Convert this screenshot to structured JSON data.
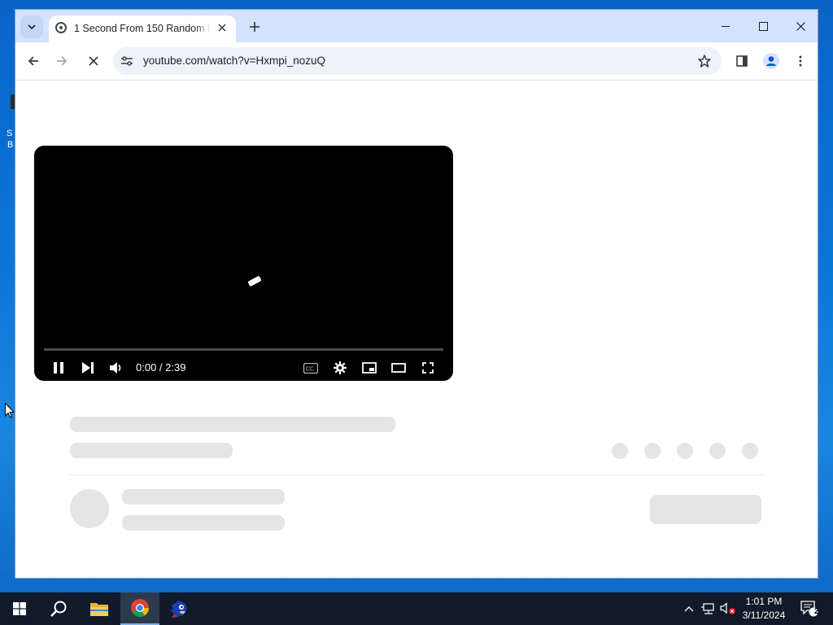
{
  "desktop": {
    "icon_text_1": "S",
    "icon_text_2": "B"
  },
  "browser": {
    "tab": {
      "title": "1 Second From 150 Random M"
    },
    "address": {
      "url": "youtube.com/watch?v=Hxmpi_nozuQ"
    }
  },
  "player": {
    "time": "0:00 / 2:39",
    "progress_fraction": 0.0,
    "state": "loading"
  },
  "taskbar": {
    "clock": {
      "time": "1:01 PM",
      "date": "3/11/2024"
    },
    "notification_count": "2"
  },
  "icons": {
    "tab_search": "chevron-down-icon",
    "favicon": "site-favicon-icon",
    "tab_close": "close-icon",
    "new_tab": "plus-icon",
    "back": "arrow-left-icon",
    "forward": "arrow-right-icon",
    "stop": "close-icon",
    "site_info": "tune-icon",
    "bookmark": "star-icon",
    "side_panel": "side-panel-icon",
    "profile": "profile-icon",
    "menu": "kebab-menu-icon"
  },
  "colors": {
    "tabstrip": "#d3e3fd",
    "omnibox": "#eef2f9",
    "skeleton": "#e5e5e5",
    "taskbar": "#101a28"
  }
}
